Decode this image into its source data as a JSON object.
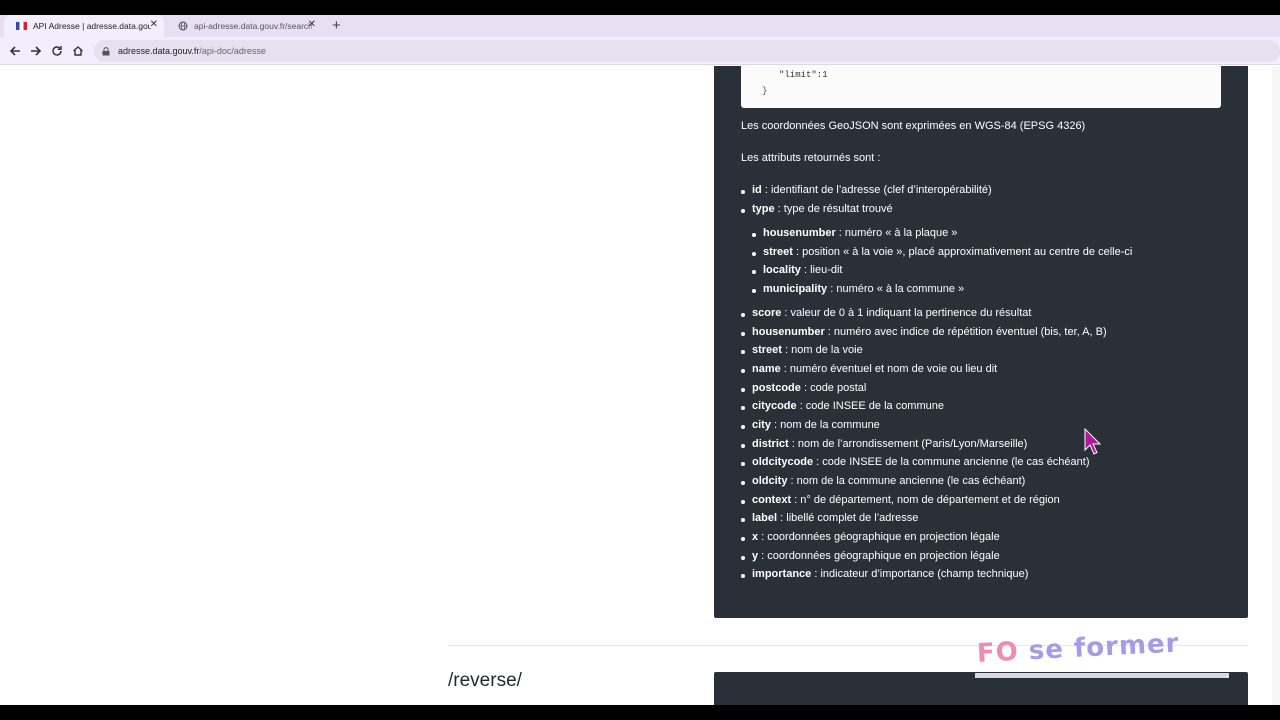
{
  "browser": {
    "tabs": [
      {
        "title": "API Adresse | adresse.data.gouv.fr",
        "active": true
      },
      {
        "title": "api-adresse.data.gouv.fr/search/?q",
        "active": false
      }
    ],
    "url_host": "adresse.data.gouv.fr",
    "url_path": "/api-doc/adresse"
  },
  "code": {
    "line1": "\"limit\":1",
    "line2": "}"
  },
  "paragraphs": {
    "coords": "Les coordonnées GeoJSON sont exprimées en WGS-84 (EPSG 4326)",
    "attrs_intro": "Les attributs retournés sont :"
  },
  "attributes": [
    {
      "key": "id",
      "desc": " : identifiant de l’adresse (clef d’interopérabilité)"
    },
    {
      "key": "type",
      "desc": " : type de résultat trouvé"
    },
    {
      "key": "score",
      "desc": " : valeur de 0 à 1 indiquant la pertinence du résultat"
    },
    {
      "key": "housenumber",
      "desc": " : numéro avec indice de répétition éventuel (bis, ter, A, B)"
    },
    {
      "key": "street",
      "desc": " : nom de la voie"
    },
    {
      "key": "name",
      "desc": " : numéro éventuel et nom de voie ou lieu dit"
    },
    {
      "key": "postcode",
      "desc": " : code postal"
    },
    {
      "key": "citycode",
      "desc": " : code INSEE de la commune"
    },
    {
      "key": "city",
      "desc": " : nom de la commune"
    },
    {
      "key": "district",
      "desc": " : nom de l’arrondissement (Paris/Lyon/Marseille)"
    },
    {
      "key": "oldcitycode",
      "desc": " : code INSEE de la commune ancienne (le cas échéant)"
    },
    {
      "key": "oldcity",
      "desc": " : nom de la commune ancienne (le cas échéant)"
    },
    {
      "key": "context",
      "desc": " : n° de département, nom de département et de région"
    },
    {
      "key": "label",
      "desc": " : libellé complet de l’adresse"
    },
    {
      "key": "x",
      "desc": " : coordonnées géographique en projection légale"
    },
    {
      "key": "y",
      "desc": " : coordonnées géographique en projection légale"
    },
    {
      "key": "importance",
      "desc": " : indicateur d’importance (champ technique)"
    }
  ],
  "types": [
    {
      "key": "housenumber",
      "desc": " : numéro « à la plaque »"
    },
    {
      "key": "street",
      "desc": " : position « à la voie », placé approximativement au centre de celle-ci"
    },
    {
      "key": "locality",
      "desc": " : lieu-dit"
    },
    {
      "key": "municipality",
      "desc": " : numéro « à la commune »"
    }
  ],
  "sections": {
    "reverse_title": "/reverse/"
  },
  "watermark": {
    "part1": "FO",
    "part2": "se former"
  }
}
